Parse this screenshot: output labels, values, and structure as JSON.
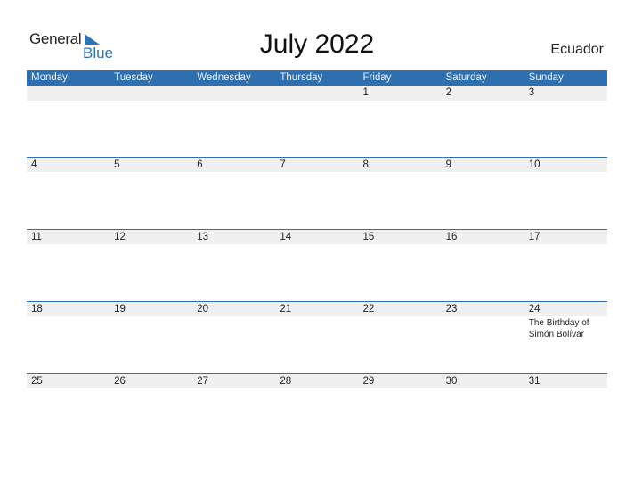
{
  "logo": {
    "text_general": "General",
    "text_blue": "Blue",
    "icon": "triangle-flag-icon"
  },
  "title": "July 2022",
  "country": "Ecuador",
  "weekdays": [
    "Monday",
    "Tuesday",
    "Wednesday",
    "Thursday",
    "Friday",
    "Saturday",
    "Sunday"
  ],
  "weeks": [
    {
      "days": [
        "",
        "",
        "",
        "",
        "1",
        "2",
        "3"
      ],
      "events": [
        "",
        "",
        "",
        "",
        "",
        "",
        ""
      ]
    },
    {
      "days": [
        "4",
        "5",
        "6",
        "7",
        "8",
        "9",
        "10"
      ],
      "events": [
        "",
        "",
        "",
        "",
        "",
        "",
        ""
      ]
    },
    {
      "days": [
        "11",
        "12",
        "13",
        "14",
        "15",
        "16",
        "17"
      ],
      "events": [
        "",
        "",
        "",
        "",
        "",
        "",
        ""
      ]
    },
    {
      "days": [
        "18",
        "19",
        "20",
        "21",
        "22",
        "23",
        "24"
      ],
      "events": [
        "",
        "",
        "",
        "",
        "",
        "",
        "The Birthday of Simón Bolívar"
      ]
    },
    {
      "days": [
        "25",
        "26",
        "27",
        "28",
        "29",
        "30",
        "31"
      ],
      "events": [
        "",
        "",
        "",
        "",
        "",
        "",
        ""
      ]
    }
  ],
  "colors": {
    "header_bg": "#2e6fb0",
    "accent": "#2b73b8",
    "day_bar": "#f0f0f0"
  }
}
